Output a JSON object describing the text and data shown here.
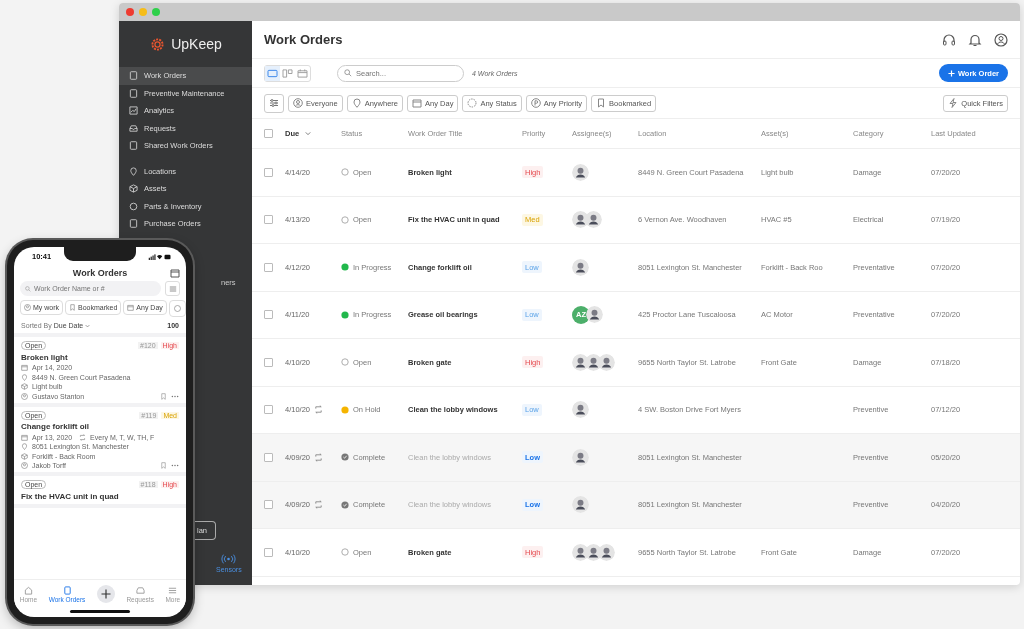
{
  "sidebar": {
    "logo": "UpKeep",
    "items": [
      {
        "label": "Work Orders",
        "selected": true
      },
      {
        "label": "Preventive Maintenance",
        "selected": false
      },
      {
        "label": "Analytics",
        "selected": false
      },
      {
        "label": "Requests",
        "selected": false
      },
      {
        "label": "Shared Work Orders",
        "selected": false
      },
      {
        "label": "Locations",
        "selected": false
      },
      {
        "label": "Assets",
        "selected": false
      },
      {
        "label": "Parts & Inventory",
        "selected": false
      },
      {
        "label": "Purchase Orders",
        "selected": false
      }
    ],
    "covered_item": "ners",
    "covered_button": "lan",
    "bottom_tab": {
      "label": "Sensors",
      "selected": true
    }
  },
  "header": {
    "title": "Work Orders"
  },
  "toolbar": {
    "views": [
      {
        "selected": true
      },
      {
        "selected": false
      },
      {
        "selected": false
      }
    ],
    "search_placeholder": "Search...",
    "count": "4 Work Orders",
    "new_button": "Work Order"
  },
  "filters": [
    "Everyone",
    "Anywhere",
    "Any Day",
    "Any Status",
    "Any Priority",
    "Bookmarked"
  ],
  "quick_filters": "Quick Filters",
  "table": {
    "select_all_checked": false,
    "columns": [
      "Due",
      "Status",
      "Work Order Title",
      "Priority",
      "Assignee(s)",
      "Location",
      "Asset(s)",
      "Category",
      "Last Updated"
    ],
    "rows": [
      {
        "checked": false,
        "due": "4/14/20",
        "recurring": false,
        "status": {
          "label": "Open",
          "kind": "open"
        },
        "title": "Broken light",
        "priority": {
          "label": "High",
          "kind": "high"
        },
        "assignees": [
          {
            "kind": "photo"
          }
        ],
        "location": "8449 N. Green Court Pasadena",
        "asset": "Light bulb",
        "category": "Damage",
        "updated": "07/20/20"
      },
      {
        "checked": false,
        "due": "4/13/20",
        "recurring": false,
        "status": {
          "label": "Open",
          "kind": "open"
        },
        "title": "Fix the HVAC unit in quad",
        "priority": {
          "label": "Med",
          "kind": "med"
        },
        "assignees": [
          {
            "kind": "photo"
          },
          {
            "kind": "photo"
          }
        ],
        "location": "6 Vernon Ave. Woodhaven",
        "asset": "HVAC #5",
        "category": "Electrical",
        "updated": "07/19/20"
      },
      {
        "checked": false,
        "due": "4/12/20",
        "recurring": false,
        "status": {
          "label": "In Progress",
          "kind": "in_progress"
        },
        "title": "Change forklift oil",
        "priority": {
          "label": "Low",
          "kind": "low"
        },
        "assignees": [
          {
            "kind": "photo"
          }
        ],
        "location": "8051 Lexington St. Manchester",
        "asset": "Forklift - Back Roo",
        "category": "Preventative",
        "updated": "07/20/20"
      },
      {
        "checked": false,
        "due": "4/11/20",
        "recurring": false,
        "status": {
          "label": "In Progress",
          "kind": "in_progress"
        },
        "title": "Grease oil bearings",
        "priority": {
          "label": "Low",
          "kind": "low"
        },
        "assignees": [
          {
            "kind": "initials",
            "initials": "AZ",
            "color": "#4caf6a"
          },
          {
            "kind": "photo"
          }
        ],
        "location": "425 Proctor Lane Tuscaloosa",
        "asset": "AC Motor",
        "category": "Preventative",
        "updated": "07/20/20"
      },
      {
        "checked": false,
        "due": "4/10/20",
        "recurring": false,
        "status": {
          "label": "Open",
          "kind": "open"
        },
        "title": "Broken gate",
        "priority": {
          "label": "High",
          "kind": "high"
        },
        "assignees": [
          {
            "kind": "photo"
          },
          {
            "kind": "photo"
          },
          {
            "kind": "photo"
          }
        ],
        "location": "9655 North Taylor St. Latrobe",
        "asset": "Front Gate",
        "category": "Damage",
        "updated": "07/18/20"
      },
      {
        "checked": false,
        "due": "4/10/20",
        "recurring": true,
        "status": {
          "label": "On Hold",
          "kind": "on_hold"
        },
        "title": "Clean the lobby windows",
        "priority": {
          "label": "Low",
          "kind": "low"
        },
        "assignees": [
          {
            "kind": "photo"
          }
        ],
        "location": "4 SW. Boston Drive Fort Myers",
        "category": "Preventive",
        "updated": "07/12/20"
      },
      {
        "checked": false,
        "due": "4/09/20",
        "recurring": true,
        "status": {
          "label": "Complete",
          "kind": "complete"
        },
        "title": "Clean the lobby windows",
        "priority": {
          "label": "Low",
          "kind": "low"
        },
        "assignees": [
          {
            "kind": "photo"
          }
        ],
        "location": "8051 Lexington St. Manchester",
        "category": "Preventive",
        "updated": "05/20/20"
      },
      {
        "checked": false,
        "due": "4/09/20",
        "recurring": true,
        "status": {
          "label": "Complete",
          "kind": "complete"
        },
        "title": "Clean the lobby windows",
        "priority": {
          "label": "Low",
          "kind": "low"
        },
        "assignees": [
          {
            "kind": "photo"
          }
        ],
        "location": "8051 Lexington St. Manchester",
        "category": "Preventive",
        "updated": "04/20/20"
      },
      {
        "checked": false,
        "due": "4/10/20",
        "recurring": false,
        "status": {
          "label": "Open",
          "kind": "open"
        },
        "title": "Broken gate",
        "priority": {
          "label": "High",
          "kind": "high"
        },
        "assignees": [
          {
            "kind": "photo"
          },
          {
            "kind": "photo"
          },
          {
            "kind": "photo"
          }
        ],
        "location": "9655 North Taylor St. Latrobe",
        "asset": "Front Gate",
        "category": "Damage",
        "updated": "07/20/20"
      }
    ]
  },
  "phone": {
    "time": "10:41",
    "title": "Work Orders",
    "search_placeholder": "Work Order Name or #",
    "chips": [
      "My work",
      "Bookmarked",
      "Any Day"
    ],
    "sort": "Sorted By **Due Date**",
    "total": "100",
    "cards": [
      {
        "status": "Open",
        "number": "#120",
        "priority": {
          "label": "High",
          "kind": "high"
        },
        "title": "Broken light",
        "date": "Apr 14, 2020",
        "location": "8449 N. Green Court Pasadena",
        "asset": "Light bulb",
        "assignee": "Gustavo Stanton"
      },
      {
        "status": "Open",
        "number": "#119",
        "priority": {
          "label": "Med",
          "kind": "med"
        },
        "title": "Change forklift oil",
        "date": "Apr 13, 2020",
        "repeat": "Every M, T, W, TH, F",
        "location": "8051 Lexington St. Manchester",
        "asset": "Forklift - Back Room",
        "assignee": "Jakob Torff"
      },
      {
        "status": "Open",
        "number": "#118",
        "priority": {
          "label": "High",
          "kind": "high"
        },
        "title": "Fix the HVAC unit in quad"
      }
    ],
    "tabs": [
      {
        "label": "Home",
        "selected": false
      },
      {
        "label": "Work Orders",
        "selected": true
      },
      {
        "selected": false
      },
      {
        "label": "Requests",
        "selected": false
      },
      {
        "label": "More",
        "selected": false
      }
    ]
  }
}
